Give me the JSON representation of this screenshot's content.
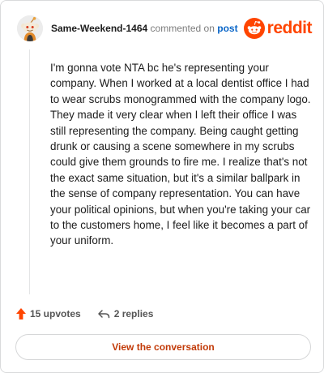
{
  "header": {
    "author": "Same-Weekend-1464",
    "commented_text": " commented on ",
    "post_link": "post",
    "brand_wordmark": "reddit",
    "avatar_icon": "snoo-avatar-icon",
    "brand_icon": "reddit-snoo-icon"
  },
  "comment": {
    "body": "I'm gonna vote NTA bc he's representing your company. When I worked at a local dentist office I had to wear scrubs monogrammed with the company logo. They made it very clear when I left their office I was still representing the company. Being caught getting drunk or causing a scene somewhere in my scrubs could give them grounds to fire me. I realize that's not the exact same situation, but it's a similar ballpark in the sense of company representation. You can have your political opinions, but when you're taking your car to the customers home, I feel like it becomes a part of your uniform."
  },
  "actions": {
    "upvotes": "15 upvotes",
    "replies": "2 replies",
    "upvote_icon": "upvote-arrow-icon",
    "reply_icon": "reply-arrow-icon"
  },
  "footer": {
    "view_label": "View the conversation"
  },
  "colors": {
    "brand": "#ff4500",
    "link": "#0a66c8",
    "button_text": "#c23a08",
    "muted": "#7c7c7c"
  }
}
